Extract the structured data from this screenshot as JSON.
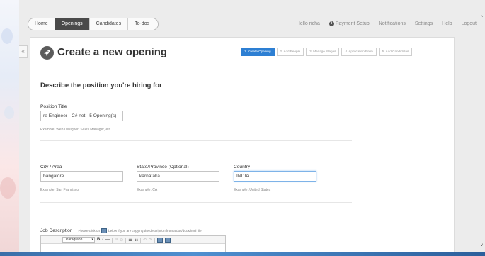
{
  "nav": {
    "tabs": [
      "Home",
      "Openings",
      "Candidates",
      "To-dos"
    ],
    "active_tab": 1,
    "user_greeting": "Hello richa",
    "payment_setup": "Payment Setup",
    "notifications": "Notifications",
    "settings": "Settings",
    "help": "Help",
    "logout": "Logout"
  },
  "page": {
    "title": "Create a new opening",
    "section_title": "Describe the position you're hiring for"
  },
  "steps": [
    "1. Create Opening",
    "2. Add People",
    "3. Manage Stages",
    "4. Application Form",
    "5. Add Candidates"
  ],
  "form": {
    "position_title": {
      "label": "Position Title",
      "value": "re Engineer - C# net - 5 Opening(s)",
      "hint": "Example: Web Designer, Sales Manager, etc"
    },
    "city": {
      "label": "City / Area",
      "value": "bangalore",
      "hint": "Example: San Francisco"
    },
    "state": {
      "label": "State/Province (Optional)",
      "value": "karnataka",
      "hint": "Example: CA"
    },
    "country": {
      "label": "Country",
      "value": "INDIA",
      "hint": "Example: United States"
    },
    "job_description": {
      "label": "Job Description",
      "note_before": "Please click on",
      "note_after": "below if you are copying the description from a doc/docx/html file"
    }
  },
  "editor": {
    "format_value": "Paragraph",
    "bold": "B",
    "italic": "I",
    "hr": "—",
    "link": "∞",
    "unlink": "⊘",
    "bullets": "☰",
    "numbers": "☷",
    "undo": "↶",
    "redo": "↷"
  },
  "icons": {
    "collapse": "«",
    "scroll_up": "^",
    "scroll_down": "v",
    "format_arrow": "▾"
  },
  "colors": {
    "accent": "#2d7fd3",
    "nav_active": "#4a4a4a"
  }
}
